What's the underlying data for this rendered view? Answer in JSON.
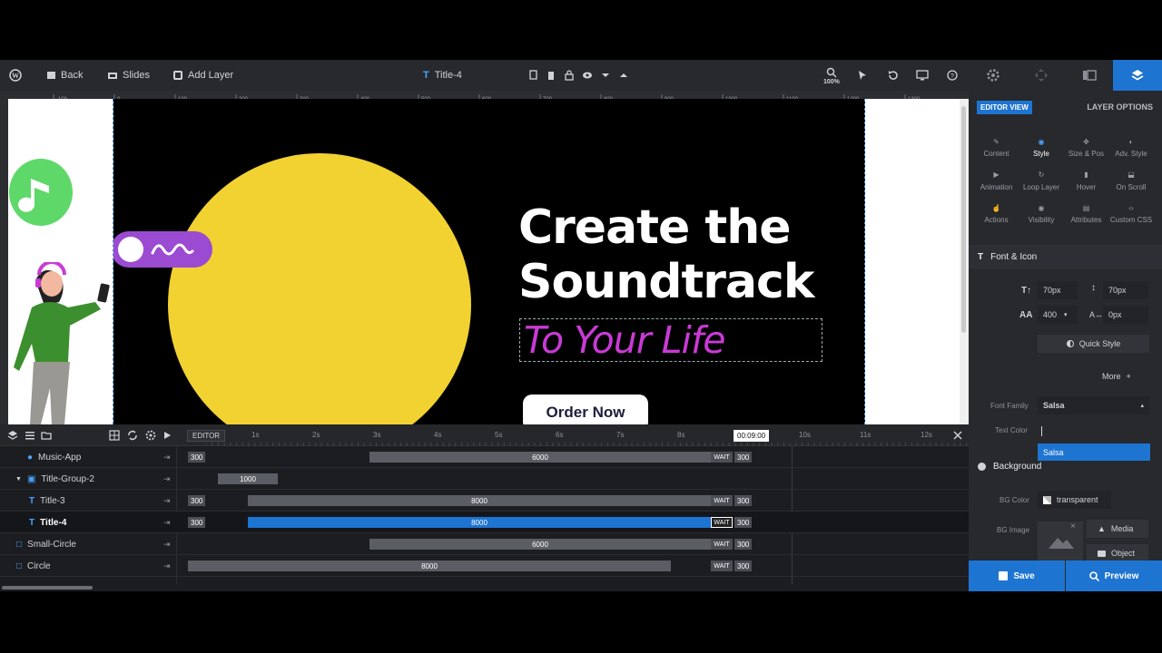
{
  "topbar": {
    "back": "Back",
    "slides": "Slides",
    "add_layer": "Add Layer",
    "layer_title": "Title-4",
    "zoom": "100%"
  },
  "ruler": {
    "ticks": [
      "-100",
      "0",
      "100",
      "200",
      "300",
      "400",
      "500",
      "600",
      "700",
      "800",
      "900",
      "1000",
      "1100",
      "1200",
      "1300"
    ]
  },
  "slide": {
    "headline_1": "Create the",
    "headline_2": "Soundtrack",
    "headline_3": "To Your Life",
    "cta": "Order Now"
  },
  "timeline": {
    "mode": "EDITOR",
    "current_time": "00:09:00",
    "time_marks": [
      "1s",
      "2s",
      "3s",
      "4s",
      "5s",
      "6s",
      "7s",
      "8s",
      "10s",
      "11s",
      "12s"
    ],
    "layers": [
      {
        "name": "Music-App",
        "start": "300",
        "duration": "6000",
        "wait": "WAIT",
        "end": "300"
      },
      {
        "name": "Title-Group-2",
        "start": "",
        "duration": "1000",
        "wait": "",
        "end": ""
      },
      {
        "name": "Title-3",
        "start": "300",
        "duration": "8000",
        "wait": "WAIT",
        "end": "300"
      },
      {
        "name": "Title-4",
        "start": "300",
        "duration": "8000",
        "wait": "WAIT",
        "end": "300"
      },
      {
        "name": "Small-Circle",
        "start": "",
        "duration": "6000",
        "wait": "WAIT",
        "end": "300"
      },
      {
        "name": "Circle",
        "start": "",
        "duration": "8000",
        "wait": "WAIT",
        "end": "300"
      }
    ]
  },
  "panel": {
    "editor_view": "EDITOR VIEW",
    "layer_options": "LAYER OPTIONS",
    "tabs": [
      "Content",
      "Style",
      "Size & Pos",
      "Adv. Style",
      "Animation",
      "Loop Layer",
      "Hover",
      "On Scroll",
      "Actions",
      "Visibility",
      "Attributes",
      "Custom CSS"
    ],
    "font_icon_section": "Font & Icon",
    "font_size": "70px",
    "line_height": "70px",
    "font_weight": "400",
    "letter_spacing": "0px",
    "quick_style": "Quick Style",
    "more": "More",
    "font_family_label": "Font Family",
    "font_family_value": "Salsa",
    "text_color_label": "Text Color",
    "dropdown_option": "Salsa",
    "background_section": "Background",
    "bg_color_label": "BG Color",
    "bg_color_value": "transparent",
    "bg_image_label": "BG Image",
    "media": "Media",
    "object": "Object",
    "save": "Save",
    "preview": "Preview"
  },
  "colors": {
    "accent": "#1e74d1",
    "yellow": "#f2d231",
    "pink": "#c93ad6",
    "green": "#5fd86a",
    "purple": "#9b4ad2"
  }
}
